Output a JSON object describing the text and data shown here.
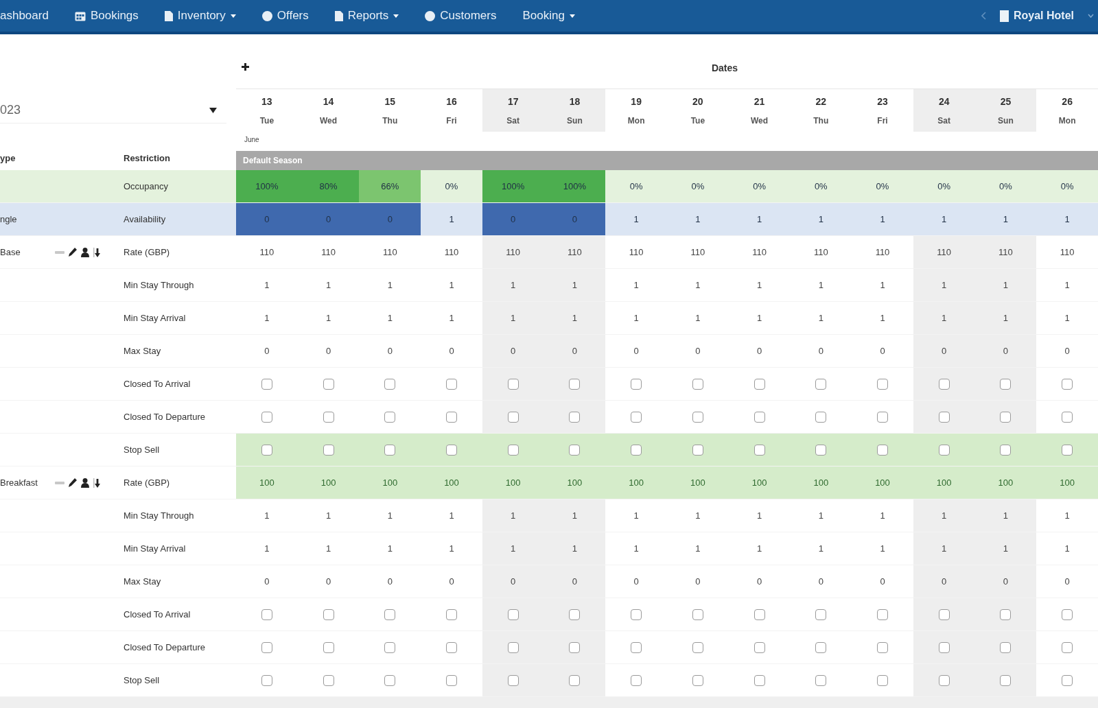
{
  "nav": {
    "items": [
      {
        "label": "ashboard",
        "dropdown": false
      },
      {
        "label": "Bookings",
        "dropdown": false
      },
      {
        "label": "Inventory",
        "dropdown": true
      },
      {
        "label": "Offers",
        "dropdown": false
      },
      {
        "label": "Reports",
        "dropdown": true
      },
      {
        "label": "Customers",
        "dropdown": false
      },
      {
        "label": "Booking",
        "dropdown": true
      }
    ],
    "property": {
      "label": "Royal Hotel"
    }
  },
  "filter": {
    "value": "023"
  },
  "grid": {
    "title": "Dates",
    "month": "June",
    "season": "Default Season",
    "columns": {
      "type": "ype",
      "restriction": "Restriction"
    },
    "dates": [
      {
        "day": "13",
        "weekday": "Tue",
        "weekend": false
      },
      {
        "day": "14",
        "weekday": "Wed",
        "weekend": false
      },
      {
        "day": "15",
        "weekday": "Thu",
        "weekend": false
      },
      {
        "day": "16",
        "weekday": "Fri",
        "weekend": false
      },
      {
        "day": "17",
        "weekday": "Sat",
        "weekend": true
      },
      {
        "day": "18",
        "weekday": "Sun",
        "weekend": true
      },
      {
        "day": "19",
        "weekday": "Mon",
        "weekend": false
      },
      {
        "day": "20",
        "weekday": "Tue",
        "weekend": false
      },
      {
        "day": "21",
        "weekday": "Wed",
        "weekend": false
      },
      {
        "day": "22",
        "weekday": "Thu",
        "weekend": false
      },
      {
        "day": "23",
        "weekday": "Fri",
        "weekend": false
      },
      {
        "day": "24",
        "weekday": "Sat",
        "weekend": true
      },
      {
        "day": "25",
        "weekday": "Sun",
        "weekend": true
      },
      {
        "day": "26",
        "weekday": "Mon",
        "weekend": false
      }
    ],
    "rows": [
      {
        "kind": "occupancy",
        "restriction": "Occupancy",
        "cells": [
          {
            "text": "100%",
            "color": "#4cae4f"
          },
          {
            "text": "80%",
            "color": "#4cae4f"
          },
          {
            "text": "66%",
            "color": "#7cc56f"
          },
          {
            "text": "0%",
            "color": "#e4f2dd"
          },
          {
            "text": "100%",
            "color": "#4cae4f"
          },
          {
            "text": "100%",
            "color": "#4cae4f"
          },
          {
            "text": "0%",
            "color": "#e4f2dd"
          },
          {
            "text": "0%",
            "color": "#e4f2dd"
          },
          {
            "text": "0%",
            "color": "#e4f2dd"
          },
          {
            "text": "0%",
            "color": "#e4f2dd"
          },
          {
            "text": "0%",
            "color": "#e4f2dd"
          },
          {
            "text": "0%",
            "color": "#e4f2dd"
          },
          {
            "text": "0%",
            "color": "#e4f2dd"
          },
          {
            "text": "0%",
            "color": "#e4f2dd"
          }
        ]
      },
      {
        "kind": "availability",
        "type": "ngle",
        "restriction": "Availability",
        "cells": [
          {
            "text": "0",
            "color": "#3f69ae"
          },
          {
            "text": "0",
            "color": "#3f69ae"
          },
          {
            "text": "0",
            "color": "#3f69ae"
          },
          {
            "text": "1",
            "color": "#dbe5f3"
          },
          {
            "text": "0",
            "color": "#3f69ae"
          },
          {
            "text": "0",
            "color": "#3f69ae"
          },
          {
            "text": "1",
            "color": "#dbe5f3"
          },
          {
            "text": "1",
            "color": "#dbe5f3"
          },
          {
            "text": "1",
            "color": "#dbe5f3"
          },
          {
            "text": "1",
            "color": "#dbe5f3"
          },
          {
            "text": "1",
            "color": "#dbe5f3"
          },
          {
            "text": "1",
            "color": "#dbe5f3"
          },
          {
            "text": "1",
            "color": "#dbe5f3"
          },
          {
            "text": "1",
            "color": "#dbe5f3"
          }
        ]
      },
      {
        "kind": "rate",
        "type": "Base",
        "restriction": "Rate (GBP)",
        "highlighted": false,
        "cells": [
          "110",
          "110",
          "110",
          "110",
          "110",
          "110",
          "110",
          "110",
          "110",
          "110",
          "110",
          "110",
          "110",
          "110"
        ]
      },
      {
        "kind": "number",
        "restriction": "Min Stay Through",
        "highlighted": false,
        "cells": [
          "1",
          "1",
          "1",
          "1",
          "1",
          "1",
          "1",
          "1",
          "1",
          "1",
          "1",
          "1",
          "1",
          "1"
        ]
      },
      {
        "kind": "number",
        "restriction": "Min Stay Arrival",
        "highlighted": false,
        "cells": [
          "1",
          "1",
          "1",
          "1",
          "1",
          "1",
          "1",
          "1",
          "1",
          "1",
          "1",
          "1",
          "1",
          "1"
        ]
      },
      {
        "kind": "number",
        "restriction": "Max Stay",
        "highlighted": false,
        "cells": [
          "0",
          "0",
          "0",
          "0",
          "0",
          "0",
          "0",
          "0",
          "0",
          "0",
          "0",
          "0",
          "0",
          "0"
        ]
      },
      {
        "kind": "checkbox",
        "restriction": "Closed To Arrival",
        "highlighted": false,
        "cells": [
          {
            "checked": false
          },
          {
            "checked": false
          },
          {
            "checked": false
          },
          {
            "checked": false
          },
          {
            "checked": false
          },
          {
            "checked": false
          },
          {
            "checked": false
          },
          {
            "checked": false
          },
          {
            "checked": false
          },
          {
            "checked": false
          },
          {
            "checked": false
          },
          {
            "checked": false
          },
          {
            "checked": false
          },
          {
            "checked": false
          }
        ]
      },
      {
        "kind": "checkbox",
        "restriction": "Closed To Departure",
        "highlighted": false,
        "cells": [
          {
            "checked": false
          },
          {
            "checked": false
          },
          {
            "checked": false
          },
          {
            "checked": false
          },
          {
            "checked": false
          },
          {
            "checked": false
          },
          {
            "checked": false
          },
          {
            "checked": false
          },
          {
            "checked": false
          },
          {
            "checked": false
          },
          {
            "checked": false
          },
          {
            "checked": false
          },
          {
            "checked": false
          },
          {
            "checked": false
          }
        ]
      },
      {
        "kind": "checkbox",
        "restriction": "Stop Sell",
        "highlighted": true,
        "cells": [
          {
            "checked": false
          },
          {
            "checked": false
          },
          {
            "checked": false
          },
          {
            "checked": false
          },
          {
            "checked": false
          },
          {
            "checked": false
          },
          {
            "checked": false
          },
          {
            "checked": false
          },
          {
            "checked": false
          },
          {
            "checked": false
          },
          {
            "checked": false
          },
          {
            "checked": false
          },
          {
            "checked": false
          },
          {
            "checked": false
          }
        ]
      },
      {
        "kind": "rate",
        "type": "Breakfast",
        "restriction": "Rate (GBP)",
        "highlighted": true,
        "cells": [
          "100",
          "100",
          "100",
          "100",
          "100",
          "100",
          "100",
          "100",
          "100",
          "100",
          "100",
          "100",
          "100",
          "100"
        ]
      },
      {
        "kind": "number",
        "restriction": "Min Stay Through",
        "highlighted": false,
        "cells": [
          "1",
          "1",
          "1",
          "1",
          "1",
          "1",
          "1",
          "1",
          "1",
          "1",
          "1",
          "1",
          "1",
          "1"
        ]
      },
      {
        "kind": "number",
        "restriction": "Min Stay Arrival",
        "highlighted": false,
        "cells": [
          "1",
          "1",
          "1",
          "1",
          "1",
          "1",
          "1",
          "1",
          "1",
          "1",
          "1",
          "1",
          "1",
          "1"
        ]
      },
      {
        "kind": "number",
        "restriction": "Max Stay",
        "highlighted": false,
        "cells": [
          "0",
          "0",
          "0",
          "0",
          "0",
          "0",
          "0",
          "0",
          "0",
          "0",
          "0",
          "0",
          "0",
          "0"
        ]
      },
      {
        "kind": "checkbox",
        "restriction": "Closed To Arrival",
        "highlighted": false,
        "cells": [
          {
            "checked": false
          },
          {
            "checked": false
          },
          {
            "checked": false
          },
          {
            "checked": false
          },
          {
            "checked": false
          },
          {
            "checked": false
          },
          {
            "checked": false
          },
          {
            "checked": false
          },
          {
            "checked": false
          },
          {
            "checked": false
          },
          {
            "checked": false
          },
          {
            "checked": false
          },
          {
            "checked": false
          },
          {
            "checked": false
          }
        ]
      },
      {
        "kind": "checkbox",
        "restriction": "Closed To Departure",
        "highlighted": false,
        "cells": [
          {
            "checked": false
          },
          {
            "checked": false
          },
          {
            "checked": false
          },
          {
            "checked": false
          },
          {
            "checked": false
          },
          {
            "checked": false
          },
          {
            "checked": false
          },
          {
            "checked": false
          },
          {
            "checked": false
          },
          {
            "checked": false
          },
          {
            "checked": false
          },
          {
            "checked": false
          },
          {
            "checked": false
          },
          {
            "checked": false
          }
        ]
      },
      {
        "kind": "checkbox",
        "restriction": "Stop Sell",
        "highlighted": false,
        "cells": [
          {
            "checked": false
          },
          {
            "checked": false
          },
          {
            "checked": false
          },
          {
            "checked": false
          },
          {
            "checked": false
          },
          {
            "checked": false
          },
          {
            "checked": false
          },
          {
            "checked": false
          },
          {
            "checked": false
          },
          {
            "checked": false
          },
          {
            "checked": false
          },
          {
            "checked": false
          },
          {
            "checked": false
          },
          {
            "checked": false
          }
        ]
      }
    ]
  }
}
